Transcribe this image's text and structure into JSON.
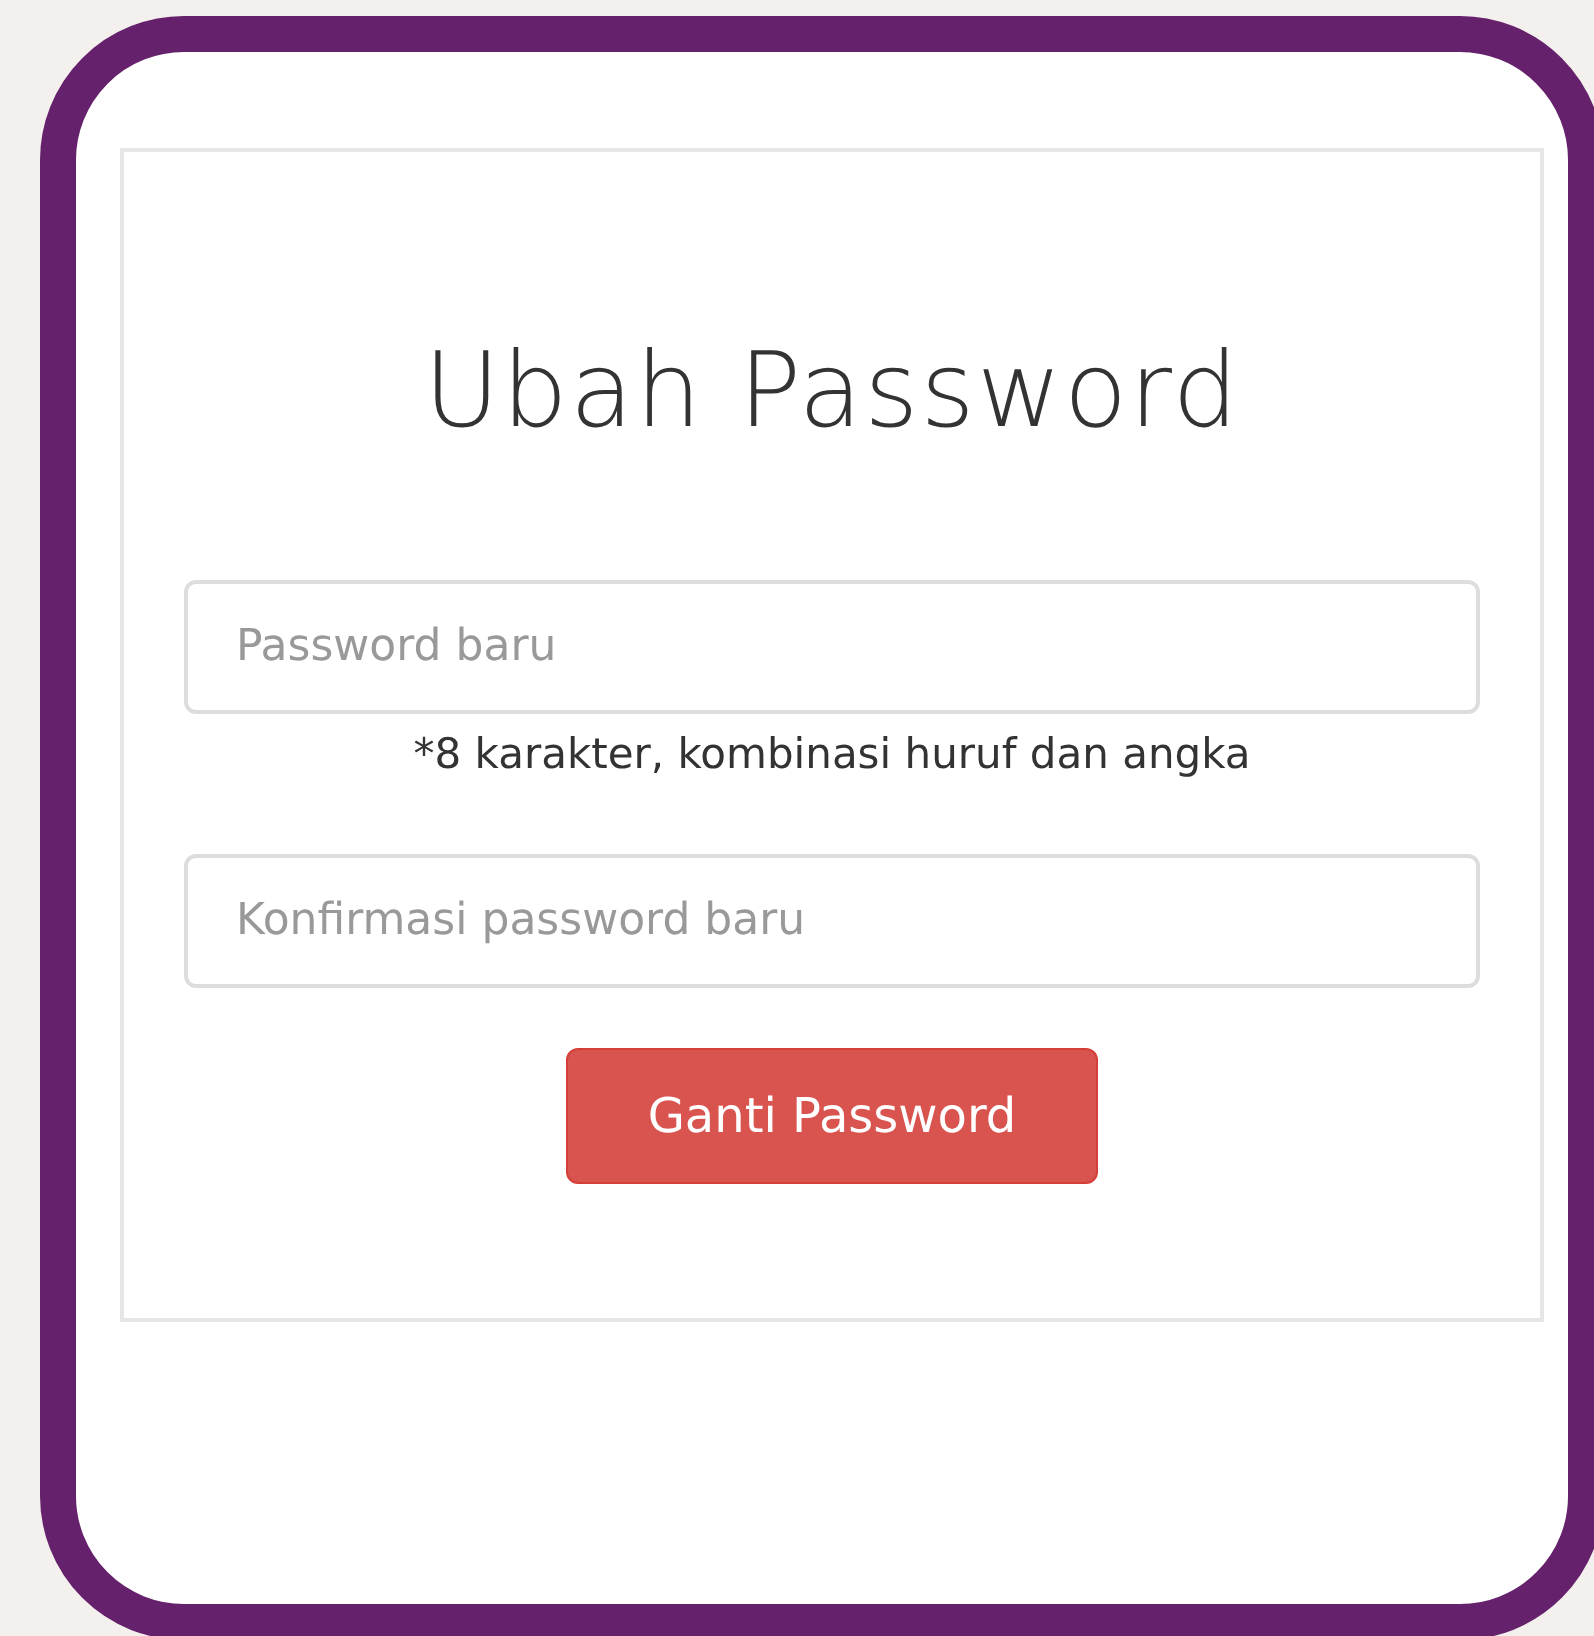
{
  "title": "Ubah Password",
  "fields": [
    {
      "placeholder": "Password baru",
      "hint": "*8 karakter, kombinasi huruf dan angka"
    },
    {
      "placeholder": "Konfirmasi password baru"
    }
  ],
  "button": "Ganti Password"
}
